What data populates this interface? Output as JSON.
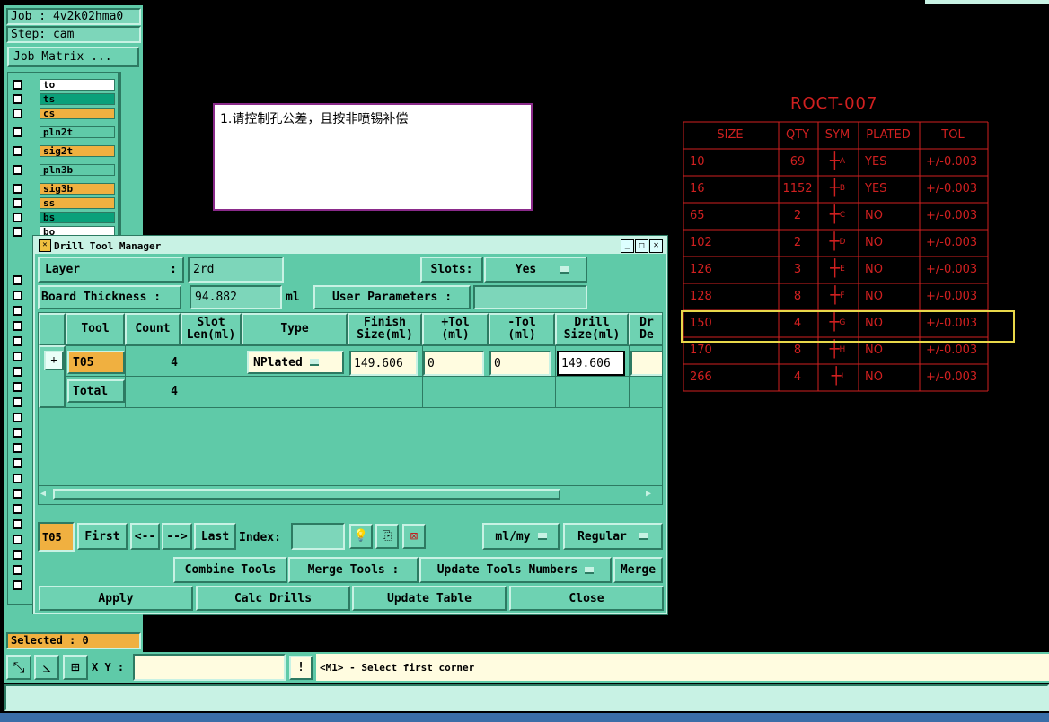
{
  "job": {
    "job_line": "Job : 4v2k02hma0",
    "step_line": "Step: cam",
    "matrix_button": "Job Matrix ..."
  },
  "layers": [
    {
      "name": "to",
      "color": "#ffffff"
    },
    {
      "name": "ts",
      "color": "#0aa07a"
    },
    {
      "name": "cs",
      "color": "#f0b040"
    },
    {
      "name": "pln2t",
      "color": "#5fcaa8"
    },
    {
      "name": "sig2t",
      "color": "#f0b040"
    },
    {
      "name": "pln3b",
      "color": "#5fcaa8"
    },
    {
      "name": "sig3b",
      "color": "#f0b040"
    },
    {
      "name": "ss",
      "color": "#f0b040"
    },
    {
      "name": "bs",
      "color": "#0aa07a"
    },
    {
      "name": "bo",
      "color": "#ffffff"
    }
  ],
  "note": {
    "text": "1.请控制孔公差，且按非喷锡补偿"
  },
  "drill_table": {
    "title": "ROCT-007",
    "headers": [
      "SIZE",
      "QTY",
      "SYM",
      "PLATED",
      "TOL"
    ],
    "rows": [
      {
        "size": "10",
        "qty": "69",
        "sym": "A",
        "plated": "YES",
        "tol": "+/-0.003"
      },
      {
        "size": "16",
        "qty": "1152",
        "sym": "B",
        "plated": "YES",
        "tol": "+/-0.003"
      },
      {
        "size": "65",
        "qty": "2",
        "sym": "C",
        "plated": "NO",
        "tol": "+/-0.003"
      },
      {
        "size": "102",
        "qty": "2",
        "sym": "D",
        "plated": "NO",
        "tol": "+/-0.003"
      },
      {
        "size": "126",
        "qty": "3",
        "sym": "E",
        "plated": "NO",
        "tol": "+/-0.003"
      },
      {
        "size": "128",
        "qty": "8",
        "sym": "F",
        "plated": "NO",
        "tol": "+/-0.003"
      },
      {
        "size": "150",
        "qty": "4",
        "sym": "G",
        "plated": "NO",
        "tol": "+/-0.003"
      },
      {
        "size": "170",
        "qty": "8",
        "sym": "H",
        "plated": "NO",
        "tol": "+/-0.003"
      },
      {
        "size": "266",
        "qty": "4",
        "sym": "I",
        "plated": "NO",
        "tol": "+/-0.003"
      }
    ],
    "highlighted_size": "150"
  },
  "dialog": {
    "title": "Drill Tool Manager",
    "layer_label": "Layer",
    "layer_colon": ":",
    "layer_value": "2rd",
    "slots_label": "Slots:",
    "slots_value": "Yes",
    "thickness_label": "Board Thickness :",
    "thickness_value": "94.882",
    "thickness_unit": "ml",
    "user_params_label": "User Parameters :",
    "user_params_value": "",
    "columns": [
      "Tool",
      "Count",
      "Slot Len(ml)",
      "Type",
      "Finish Size(ml)",
      "+Tol (ml)",
      "-Tol (ml)",
      "Drill Size(ml)",
      "Dr De"
    ],
    "tool_row": {
      "tool": "T05",
      "count": "4",
      "type": "NPlated",
      "finish": "149.606",
      "plus_tol": "0",
      "minus_tol": "0",
      "drill": "149.606"
    },
    "total_row": {
      "label": "Total",
      "count": "4"
    },
    "nav": {
      "current": "T05",
      "first": "First",
      "prev": "<--",
      "next": "-->",
      "last": "Last",
      "index_label": "Index:",
      "units": "ml/my",
      "mode": "Regular"
    },
    "actions": {
      "combine": "Combine Tools",
      "merge_tools": "Merge Tools :",
      "update_numbers": "Update Tools Numbers",
      "merge": "Merge"
    },
    "bottom": {
      "apply": "Apply",
      "calc": "Calc Drills",
      "update_table": "Update Table",
      "close": "Close"
    }
  },
  "status": {
    "selected": "Selected : 0",
    "xy_label": "X Y :",
    "xy_value": "",
    "message": "<M1> - Select first corner"
  }
}
